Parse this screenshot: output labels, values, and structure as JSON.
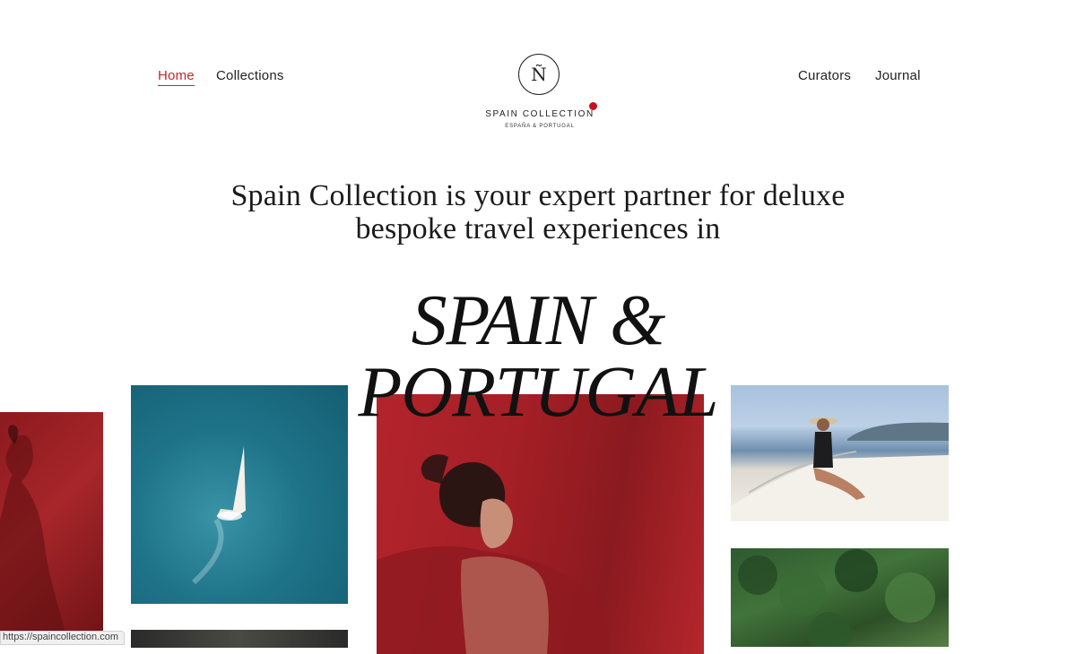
{
  "nav": {
    "home": "Home",
    "collections": "Collections",
    "curators": "Curators",
    "journal": "Journal"
  },
  "logo": {
    "monogram": "Ñ",
    "name": "SPAIN COLLECTION",
    "subtitle": "ESPAÑA & PORTUGAL"
  },
  "hero": {
    "tagline_line1": "Spain Collection is your expert partner for deluxe",
    "tagline_line2": "bespoke travel experiences in",
    "headline_line1": "SPAIN &",
    "headline_line2": "PORTUGAL"
  },
  "status": {
    "url": "https://spaincollection.com"
  },
  "colors": {
    "accent": "#c8262d",
    "logo_dot": "#c8111f",
    "text": "#1a1a1a"
  }
}
